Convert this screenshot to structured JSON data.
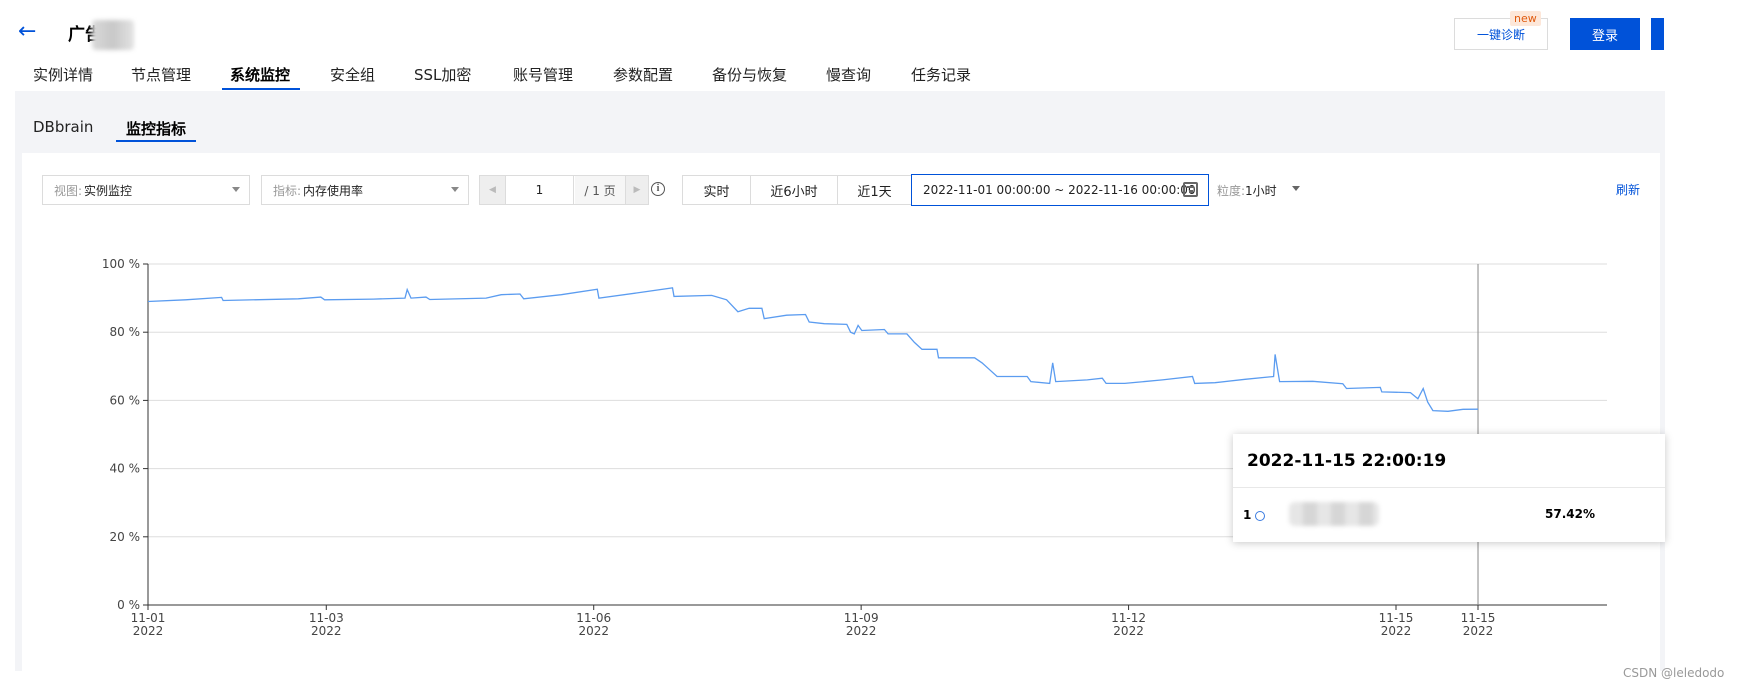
{
  "header": {
    "title": "广告",
    "diagnose_label": "一键诊断",
    "diagnose_badge": "new",
    "login_label": "登录"
  },
  "main_tabs": [
    {
      "label": "实例详情"
    },
    {
      "label": "节点管理"
    },
    {
      "label": "系统监控",
      "active": true
    },
    {
      "label": "安全组"
    },
    {
      "label": "SSL加密"
    },
    {
      "label": "账号管理"
    },
    {
      "label": "参数配置"
    },
    {
      "label": "备份与恢复"
    },
    {
      "label": "慢查询"
    },
    {
      "label": "任务记录"
    }
  ],
  "sub_tabs": [
    {
      "label": "DBbrain"
    },
    {
      "label": "监控指标",
      "active": true
    }
  ],
  "controls": {
    "view_label": "视图:",
    "view_value": "实例监控",
    "metric_label": "指标:",
    "metric_value": "内存使用率",
    "page_value": "1",
    "page_total": "/ 1 页",
    "range_buttons": [
      "实时",
      "近6小时",
      "近1天"
    ],
    "date_range": "2022-11-01 00:00:00 ~ 2022-11-16 00:00:00",
    "granularity_label": "粒度:",
    "granularity_value": "1小时",
    "refresh_label": "刷新"
  },
  "chart_data": {
    "type": "line",
    "ylim": [
      0,
      100
    ],
    "y_ticks": [
      "0 %",
      "20 %",
      "40 %",
      "60 %",
      "80 %",
      "100 %"
    ],
    "x_ticks": [
      {
        "day": 0,
        "date": "11-01",
        "year": "2022"
      },
      {
        "day": 2,
        "date": "11-03",
        "year": "2022"
      },
      {
        "day": 5,
        "date": "11-06",
        "year": "2022"
      },
      {
        "day": 8,
        "date": "11-09",
        "year": "2022"
      },
      {
        "day": 11,
        "date": "11-12",
        "year": "2022"
      },
      {
        "day": 14,
        "date": "11-15",
        "year": "2022"
      },
      {
        "day": 14.92,
        "date": "11-15",
        "year": "2022"
      }
    ],
    "line_color": "#5b9cf0",
    "series": [
      {
        "name": "1",
        "points": [
          [
            0,
            89
          ],
          [
            0.5,
            89.5
          ],
          [
            0.98,
            90.2
          ],
          [
            1.0,
            89.3
          ],
          [
            2.0,
            89.8
          ],
          [
            2.3,
            90.3
          ],
          [
            2.35,
            89.5
          ],
          [
            3.0,
            89.7
          ],
          [
            3.42,
            90.0
          ],
          [
            3.45,
            92.5
          ],
          [
            3.5,
            90.0
          ],
          [
            3.7,
            90.3
          ],
          [
            3.75,
            89.6
          ],
          [
            4.5,
            90.0
          ],
          [
            4.7,
            91.0
          ],
          [
            4.95,
            91.2
          ],
          [
            5.0,
            89.8
          ],
          [
            5.5,
            91.0
          ],
          [
            5.98,
            92.6
          ],
          [
            6.0,
            90.0
          ],
          [
            6.5,
            91.5
          ],
          [
            6.98,
            93.0
          ],
          [
            7.0,
            90.5
          ],
          [
            7.5,
            90.8
          ],
          [
            7.7,
            89.5
          ],
          [
            7.85,
            86.0
          ],
          [
            8.0,
            87.0
          ],
          [
            8.17,
            87.0
          ],
          [
            8.2,
            84.0
          ],
          [
            8.5,
            85.0
          ],
          [
            8.75,
            85.2
          ],
          [
            8.8,
            83.0
          ],
          [
            9.0,
            82.5
          ],
          [
            9.3,
            82.3
          ],
          [
            9.35,
            80.0
          ],
          [
            9.4,
            79.5
          ],
          [
            9.45,
            82.0
          ],
          [
            9.5,
            80.5
          ],
          [
            9.8,
            80.8
          ],
          [
            9.85,
            79.5
          ],
          [
            10.1,
            79.5
          ],
          [
            10.2,
            77.0
          ],
          [
            10.3,
            75.0
          ],
          [
            10.5,
            75.0
          ],
          [
            10.52,
            72.5
          ],
          [
            11.0,
            72.5
          ],
          [
            11.1,
            71.0
          ],
          [
            11.2,
            69.0
          ],
          [
            11.3,
            67.0
          ],
          [
            11.7,
            67.0
          ],
          [
            11.75,
            65.5
          ],
          [
            12.0,
            65.0
          ],
          [
            12.04,
            71.0
          ],
          [
            12.08,
            65.5
          ],
          [
            12.5,
            66.0
          ],
          [
            12.7,
            66.5
          ],
          [
            12.75,
            65.0
          ],
          [
            13.0,
            65.0
          ],
          [
            13.5,
            66.0
          ],
          [
            13.9,
            67.0
          ],
          [
            13.93,
            65.0
          ],
          [
            14.2,
            65.2
          ],
          [
            14.6,
            66.2
          ],
          [
            14.98,
            67.0
          ],
          [
            15.0,
            73.5
          ],
          [
            15.06,
            65.5
          ],
          [
            15.5,
            65.6
          ],
          [
            15.9,
            64.9
          ],
          [
            15.95,
            63.5
          ],
          [
            16.4,
            63.8
          ],
          [
            16.42,
            62.5
          ],
          [
            16.8,
            62.3
          ],
          [
            16.9,
            60.5
          ],
          [
            16.97,
            63.5
          ],
          [
            17.03,
            59.5
          ],
          [
            17.1,
            57.0
          ],
          [
            17.3,
            56.8
          ],
          [
            17.5,
            57.4
          ],
          [
            17.7,
            57.42
          ]
        ]
      }
    ]
  },
  "tooltip": {
    "time": "2022-11-15 22:00:19",
    "index": "1",
    "value": "57.42%"
  },
  "watermark": "CSDN @leledodo"
}
